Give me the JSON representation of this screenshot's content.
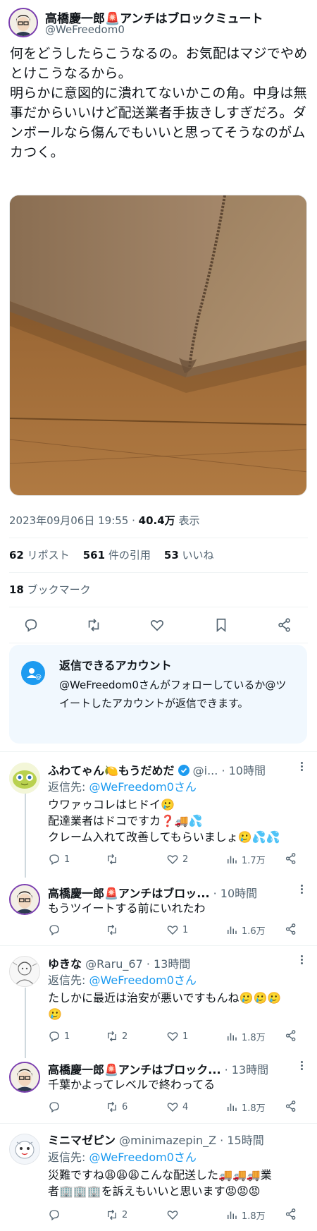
{
  "author": {
    "name": "高橋慶一郎🚨アンチはブロックミュート",
    "handle": "@WeFreedom0"
  },
  "tweet": {
    "paragraph1": "何をどうしたらこうなるの。お気配はマジでやめとけこうなるから。",
    "paragraph2": "明らかに意図的に潰れてないかこの角。中身は無事だからいいけど配送業者手抜きしすぎだろ。ダンボールなら傷んでもいいと思ってそうなのがムカつく。",
    "timestamp": "2023年09月06日 19:55 · ",
    "views_value": "40.4万",
    "views_label": " 表示"
  },
  "stats": {
    "reposts_count": "62",
    "reposts_label": " リポスト",
    "quotes_count": "561",
    "quotes_label": " 件の引用",
    "likes_count": "53",
    "likes_label": " いいね",
    "bookmarks_count": "18",
    "bookmarks_label": " ブックマーク"
  },
  "icons": [
    "reply-icon",
    "retweet-icon",
    "like-icon",
    "bookmark-icon",
    "share-icon",
    "views-icon",
    "more-icon",
    "verified-icon",
    "mention-icon"
  ],
  "reply_restriction": {
    "title": "返信できるアカウント",
    "body": "@WeFreedom0さんがフォローしているか@ツイートしたアカウントが返信できます。"
  },
  "replies": [
    {
      "name": "ふわてゃん🍋もうだめだ",
      "handle": "@i...",
      "time": "· 10時間",
      "replying_prefix": "返信先: ",
      "replying_to": "@WeFreedom0さん",
      "line1": "ウワァゥコレはヒドイ🥲",
      "line2": "配達業者はドコですカ❓🚚💦",
      "line3": "クレーム入れて改善してもらいましょ🥲💦💦",
      "reply_count": "1",
      "retweet_count": "",
      "like_count": "2",
      "views": "1.7万"
    },
    {
      "name": "高橋慶一郎🚨アンチはブロッ...",
      "time": "· 10時間",
      "line1": "もうツイートする前にいれたわ",
      "reply_count": "",
      "retweet_count": "",
      "like_count": "1",
      "views": "1.6万"
    },
    {
      "name": "ゆきな",
      "handle": "@Raru_67",
      "time": "· 13時間",
      "replying_prefix": "返信先: ",
      "replying_to": "@WeFreedom0さん",
      "line1": "たしかに最近は治安が悪いですもんね🥲🥲🥲",
      "line2": "🥲",
      "reply_count": "1",
      "retweet_count": "2",
      "like_count": "1",
      "views": "1.8万"
    },
    {
      "name": "高橋慶一郎🚨アンチはブロック...",
      "time": "· 13時間",
      "line1": "千葉かよってレベルで終わってる",
      "reply_count": "",
      "retweet_count": "6",
      "like_count": "4",
      "views": "1.8万"
    },
    {
      "name": "ミニマゼピン",
      "handle": "@minimazepin_Z",
      "time": "· 15時間",
      "replying_prefix": "返信先: ",
      "replying_to": "@WeFreedom0さん",
      "line1": "災難ですね😩😩😩こんな配送した🚚🚚🚚業",
      "line2": "者🏢🏢🏢を訴えもいいと思います😡😡😡",
      "reply_count": "",
      "retweet_count": "2",
      "like_count": "",
      "views": "1.8万"
    }
  ],
  "colors": {
    "text": "#0f1419",
    "muted": "#536471",
    "accent": "#1d9bf0",
    "divider": "#eff3f4",
    "info_box_bg": "#f1f8fe",
    "cardboard": "#a68a63",
    "floor": "#9a6a3a"
  }
}
